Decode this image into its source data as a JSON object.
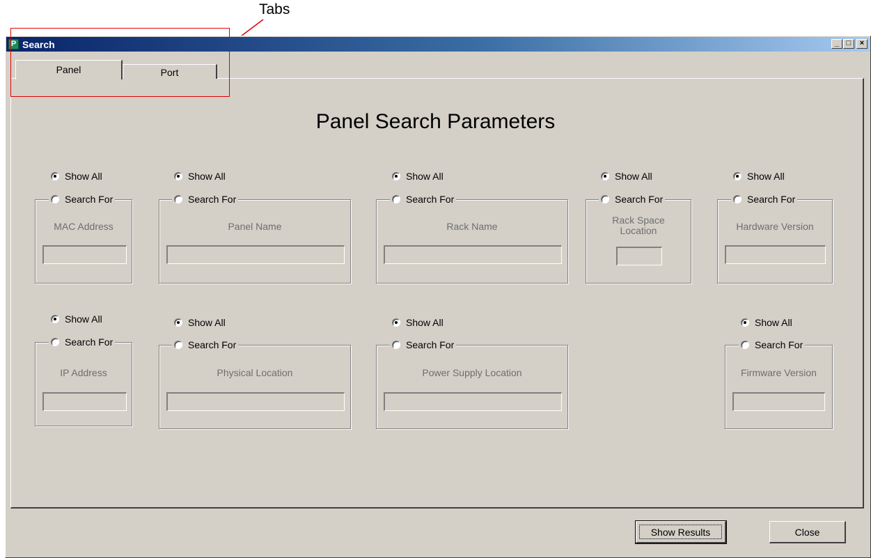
{
  "annotation": {
    "callout_label": "Tabs"
  },
  "window": {
    "title": "Search",
    "icon_glyph": "P",
    "controls": {
      "minimize": "_",
      "maximize": "□",
      "close": "×"
    }
  },
  "tabs": [
    {
      "label": "Panel",
      "active": true
    },
    {
      "label": "Port",
      "active": false
    }
  ],
  "panel_title": "Panel Search Parameters",
  "fields": {
    "mac_address": {
      "label": "MAC Address",
      "show_all": "Show All",
      "search_for": "Search For",
      "value": ""
    },
    "panel_name": {
      "label": "Panel Name",
      "show_all": "Show All",
      "search_for": "Search For",
      "value": ""
    },
    "rack_name": {
      "label": "Rack Name",
      "show_all": "Show All",
      "search_for": "Search For",
      "value": ""
    },
    "rack_space_location": {
      "label_line1": "Rack Space",
      "label_line2": "Location",
      "show_all": "Show All",
      "search_for": "Search For",
      "value": ""
    },
    "hardware_version": {
      "label": "Hardware Version",
      "show_all": "Show All",
      "search_for": "Search For",
      "value": ""
    },
    "ip_address": {
      "label": "IP Address",
      "show_all": "Show All",
      "search_for": "Search For",
      "value": ""
    },
    "physical_location": {
      "label": "Physical Location",
      "show_all": "Show All",
      "search_for": "Search For",
      "value": ""
    },
    "power_supply_location": {
      "label": "Power Supply Location",
      "show_all": "Show All",
      "search_for": "Search For",
      "value": ""
    },
    "firmware_version": {
      "label": "Firmware Version",
      "show_all": "Show All",
      "search_for": "Search For",
      "value": ""
    }
  },
  "buttons": {
    "show_results": "Show Results",
    "close": "Close"
  },
  "colors": {
    "window_bg": "#d4d0c8",
    "title_start": "#0a246a",
    "title_end": "#a6caf0",
    "callout": "#e00000"
  }
}
